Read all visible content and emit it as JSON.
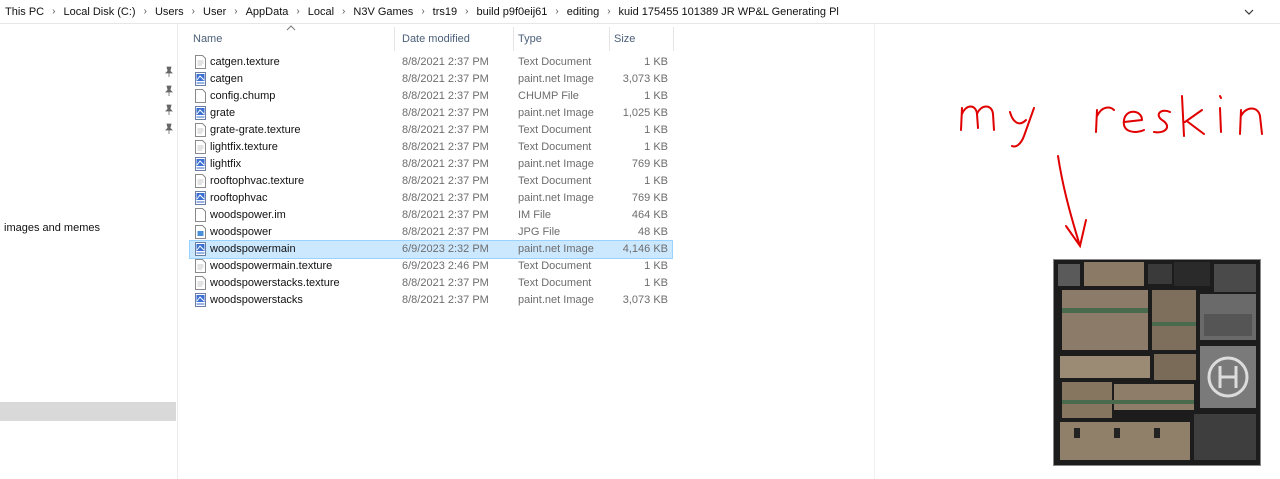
{
  "breadcrumb": [
    "This PC",
    "Local Disk (C:)",
    "Users",
    "User",
    "AppData",
    "Local",
    "N3V Games",
    "trs19",
    "build p9f0eij61",
    "editing",
    "kuid 175455 101389 JR WP&L Generating Pl"
  ],
  "nav": {
    "label": "images and memes"
  },
  "columns": {
    "name": "Name",
    "date": "Date modified",
    "type": "Type",
    "size": "Size"
  },
  "files": [
    {
      "name": "catgen.texture",
      "date": "8/8/2021 2:37 PM",
      "type": "Text Document",
      "size": "1 KB",
      "icon": "text-file-icon"
    },
    {
      "name": "catgen",
      "date": "8/8/2021 2:37 PM",
      "type": "paint.net Image",
      "size": "3,073 KB",
      "icon": "paintnet-image-icon"
    },
    {
      "name": "config.chump",
      "date": "8/8/2021 2:37 PM",
      "type": "CHUMP File",
      "size": "1 KB",
      "icon": "generic-file-icon"
    },
    {
      "name": "grate",
      "date": "8/8/2021 2:37 PM",
      "type": "paint.net Image",
      "size": "1,025 KB",
      "icon": "paintnet-image-icon"
    },
    {
      "name": "grate-grate.texture",
      "date": "8/8/2021 2:37 PM",
      "type": "Text Document",
      "size": "1 KB",
      "icon": "text-file-icon"
    },
    {
      "name": "lightfix.texture",
      "date": "8/8/2021 2:37 PM",
      "type": "Text Document",
      "size": "1 KB",
      "icon": "text-file-icon"
    },
    {
      "name": "lightfix",
      "date": "8/8/2021 2:37 PM",
      "type": "paint.net Image",
      "size": "769 KB",
      "icon": "paintnet-image-icon"
    },
    {
      "name": "rooftophvac.texture",
      "date": "8/8/2021 2:37 PM",
      "type": "Text Document",
      "size": "1 KB",
      "icon": "text-file-icon"
    },
    {
      "name": "rooftophvac",
      "date": "8/8/2021 2:37 PM",
      "type": "paint.net Image",
      "size": "769 KB",
      "icon": "paintnet-image-icon"
    },
    {
      "name": "woodspower.im",
      "date": "8/8/2021 2:37 PM",
      "type": "IM File",
      "size": "464 KB",
      "icon": "generic-file-icon"
    },
    {
      "name": "woodspower",
      "date": "8/8/2021 2:37 PM",
      "type": "JPG File",
      "size": "48 KB",
      "icon": "jpg-file-icon"
    },
    {
      "name": "woodspowermain",
      "date": "6/9/2023 2:32 PM",
      "type": "paint.net Image",
      "size": "4,146 KB",
      "icon": "paintnet-image-icon",
      "selected": true
    },
    {
      "name": "woodspowermain.texture",
      "date": "6/9/2023 2:46 PM",
      "type": "Text Document",
      "size": "1 KB",
      "icon": "text-file-icon"
    },
    {
      "name": "woodspowerstacks.texture",
      "date": "8/8/2021 2:37 PM",
      "type": "Text Document",
      "size": "1 KB",
      "icon": "text-file-icon"
    },
    {
      "name": "woodspowerstacks",
      "date": "8/8/2021 2:37 PM",
      "type": "paint.net Image",
      "size": "3,073 KB",
      "icon": "paintnet-image-icon"
    }
  ],
  "annotation": {
    "text": "my reskin",
    "color": "#e00000"
  },
  "colors": {
    "selection": "#cce8ff",
    "selection_border": "#99d1ff",
    "header_text": "#4c607a"
  }
}
